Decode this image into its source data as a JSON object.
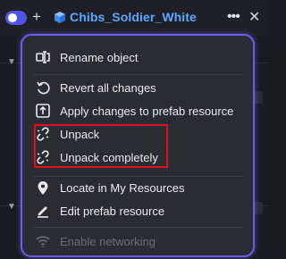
{
  "header": {
    "object_name": "Chibs_Soldier_White",
    "more_icon": "ellipsis-icon",
    "add_icon": "plus-icon",
    "close_icon": "close-icon"
  },
  "menu": {
    "items": [
      {
        "label": "Rename object",
        "icon": "rename-icon",
        "enabled": true
      },
      {
        "label": "Revert all changes",
        "icon": "revert-icon",
        "enabled": true
      },
      {
        "label": "Apply changes to prefab resource",
        "icon": "apply-icon",
        "enabled": true
      },
      {
        "label": "Unpack",
        "icon": "unlink-icon",
        "enabled": true
      },
      {
        "label": "Unpack completely",
        "icon": "unlink-icon",
        "enabled": true
      },
      {
        "label": "Locate in My Resources",
        "icon": "location-pin-icon",
        "enabled": true
      },
      {
        "label": "Edit prefab resource",
        "icon": "edit-icon",
        "enabled": true
      },
      {
        "label": "Enable networking",
        "icon": "wifi-icon",
        "enabled": false
      }
    ]
  },
  "colors": {
    "accent": "#4f56e6",
    "object_name": "#5aa8ff",
    "menu_border": "#6a5cf0",
    "highlight_box": "#e0101a"
  }
}
